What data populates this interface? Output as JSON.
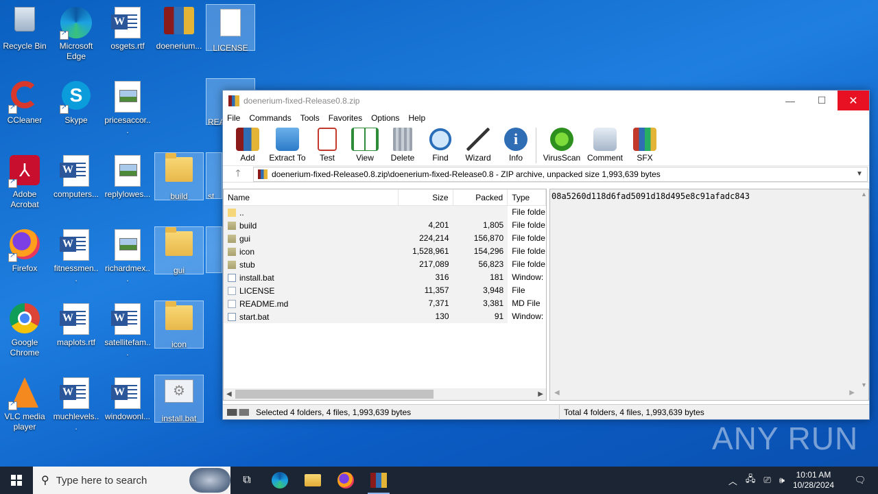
{
  "desktop": {
    "icons": [
      {
        "label": "Recycle Bin"
      },
      {
        "label": "Microsoft Edge"
      },
      {
        "label": "osgets.rtf"
      },
      {
        "label": "doenerium..."
      },
      {
        "label": "LICENSE"
      },
      {
        "label": "CCleaner"
      },
      {
        "label": "Skype"
      },
      {
        "label": "pricesaccor..."
      },
      {
        "label": "REA"
      },
      {
        "label": "Adobe Acrobat"
      },
      {
        "label": "computers..."
      },
      {
        "label": "replylowes..."
      },
      {
        "label": "build"
      },
      {
        "label": "st"
      },
      {
        "label": "Firefox"
      },
      {
        "label": "fitnessmen..."
      },
      {
        "label": "richardmex..."
      },
      {
        "label": "gui"
      },
      {
        "label": "Google Chrome"
      },
      {
        "label": "maplots.rtf"
      },
      {
        "label": "satellitefam..."
      },
      {
        "label": "icon"
      },
      {
        "label": "VLC media player"
      },
      {
        "label": "muchlevels..."
      },
      {
        "label": "windowonl..."
      },
      {
        "label": "install.bat"
      }
    ]
  },
  "window": {
    "title": "doenerium-fixed-Release0.8.zip",
    "controls": {
      "minimize": "—",
      "maximize": "☐",
      "close": "✕"
    },
    "menu": [
      "File",
      "Commands",
      "Tools",
      "Favorites",
      "Options",
      "Help"
    ],
    "toolbar": [
      {
        "label": "Add",
        "icon": "add-icon"
      },
      {
        "label": "Extract To",
        "icon": "extract-icon"
      },
      {
        "label": "Test",
        "icon": "test-icon"
      },
      {
        "label": "View",
        "icon": "view-icon"
      },
      {
        "label": "Delete",
        "icon": "delete-icon"
      },
      {
        "label": "Find",
        "icon": "find-icon"
      },
      {
        "label": "Wizard",
        "icon": "wizard-icon"
      },
      {
        "label": "Info",
        "icon": "info-icon"
      },
      {
        "label": "VirusScan",
        "icon": "virusscan-icon"
      },
      {
        "label": "Comment",
        "icon": "comment-icon"
      },
      {
        "label": "SFX",
        "icon": "sfx-icon"
      }
    ],
    "address": "doenerium-fixed-Release0.8.zip\\doenerium-fixed-Release0.8 - ZIP archive, unpacked size 1,993,639 bytes",
    "columns": {
      "name": "Name",
      "size": "Size",
      "packed": "Packed",
      "type": "Type"
    },
    "files": [
      {
        "name": "..",
        "size": "",
        "packed": "",
        "type": "File folde",
        "kind": "up"
      },
      {
        "name": "build",
        "size": "4,201",
        "packed": "1,805",
        "type": "File folde",
        "kind": "folder"
      },
      {
        "name": "gui",
        "size": "224,214",
        "packed": "156,870",
        "type": "File folde",
        "kind": "folder"
      },
      {
        "name": "icon",
        "size": "1,528,961",
        "packed": "154,296",
        "type": "File folde",
        "kind": "folder"
      },
      {
        "name": "stub",
        "size": "217,089",
        "packed": "56,823",
        "type": "File folde",
        "kind": "folder"
      },
      {
        "name": "install.bat",
        "size": "316",
        "packed": "181",
        "type": "Window:",
        "kind": "bat"
      },
      {
        "name": "LICENSE",
        "size": "11,357",
        "packed": "3,948",
        "type": "File",
        "kind": "file"
      },
      {
        "name": "README.md",
        "size": "7,371",
        "packed": "3,381",
        "type": "MD File",
        "kind": "file"
      },
      {
        "name": "start.bat",
        "size": "130",
        "packed": "91",
        "type": "Window:",
        "kind": "bat"
      }
    ],
    "comment": "08a5260d118d6fad5091d18d495e8c91afadc843",
    "status_left": "Selected 4 folders, 4 files, 1,993,639 bytes",
    "status_right": "Total 4 folders, 4 files, 1,993,639 bytes"
  },
  "watermark": "ANY RUN",
  "taskbar": {
    "search_placeholder": "Type here to search",
    "time": "10:01 AM",
    "date": "10/28/2024"
  }
}
